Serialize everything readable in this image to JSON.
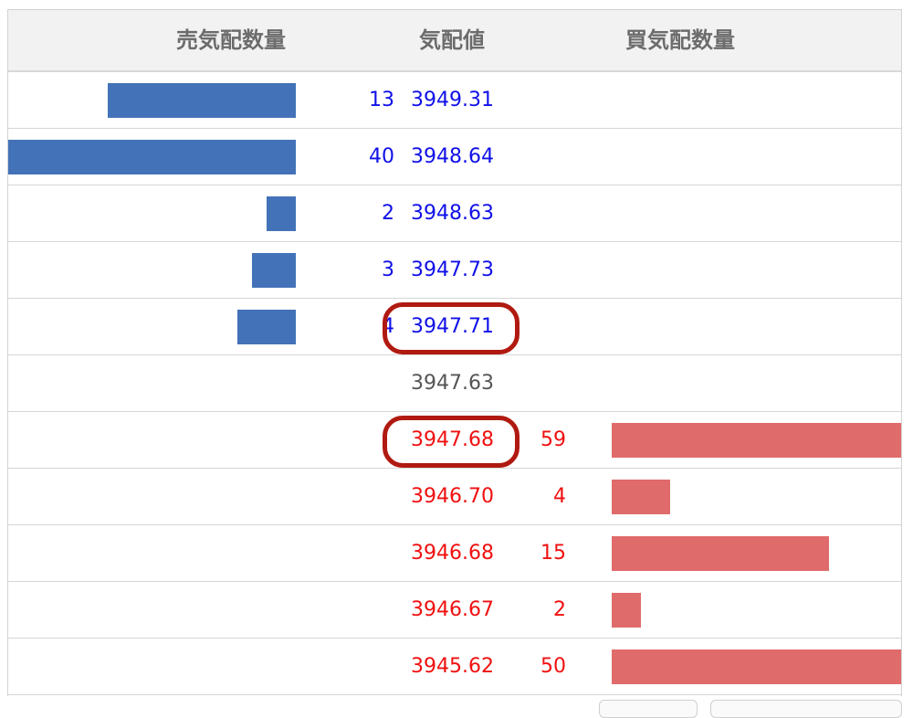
{
  "header": {
    "ask_qty_label": "売気配数量",
    "price_label": "気配値",
    "bid_qty_label": "買気配数量"
  },
  "colors": {
    "ask_bar": "#4372b8",
    "bid_bar": "#e06b6b",
    "ask_text": "#1010e8",
    "bid_text": "#f01010",
    "highlight": "#b01a10"
  },
  "asks": [
    {
      "qty": "13",
      "price": "3949.31"
    },
    {
      "qty": "40",
      "price": "3948.64"
    },
    {
      "qty": "2",
      "price": "3948.63"
    },
    {
      "qty": "3",
      "price": "3947.73"
    },
    {
      "qty": "4",
      "price": "3947.71"
    }
  ],
  "mid": {
    "price": "3947.63"
  },
  "bids": [
    {
      "qty": "59",
      "price": "3947.68"
    },
    {
      "qty": "4",
      "price": "3946.70"
    },
    {
      "qty": "15",
      "price": "3946.68"
    },
    {
      "qty": "2",
      "price": "3946.67"
    },
    {
      "qty": "50",
      "price": "3945.62"
    }
  ]
}
